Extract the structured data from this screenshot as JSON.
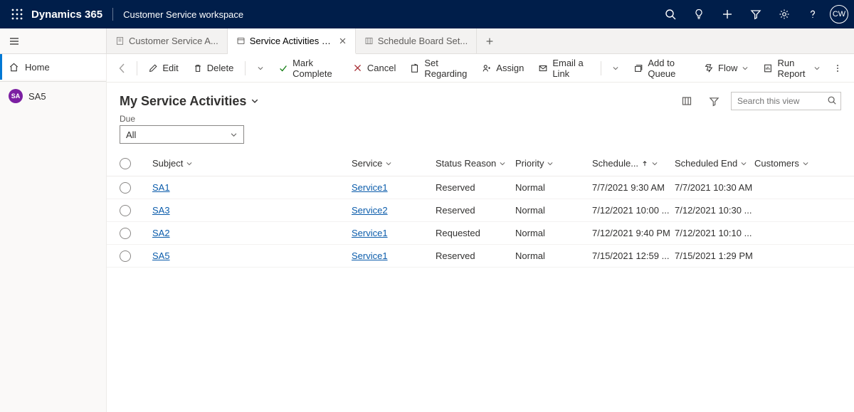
{
  "topbar": {
    "brand": "Dynamics 365",
    "area": "Customer Service workspace",
    "avatar": "CW"
  },
  "tabs": [
    {
      "label": "Customer Service A...",
      "active": false,
      "closable": false
    },
    {
      "label": "Service Activities My Ser...",
      "active": true,
      "closable": true
    },
    {
      "label": "Schedule Board Set...",
      "active": false,
      "closable": false
    }
  ],
  "sidebar": {
    "home": "Home",
    "entity_badge": "SA",
    "entity_label": "SA5"
  },
  "commands": {
    "edit": "Edit",
    "delete": "Delete",
    "mark_complete": "Mark Complete",
    "cancel": "Cancel",
    "set_regarding": "Set Regarding",
    "assign": "Assign",
    "email_link": "Email a Link",
    "add_to_queue": "Add to Queue",
    "flow": "Flow",
    "run_report": "Run Report"
  },
  "view": {
    "title": "My Service Activities",
    "search_placeholder": "Search this view",
    "due_label": "Due",
    "due_value": "All"
  },
  "columns": {
    "subject": "Subject",
    "service": "Service",
    "status": "Status Reason",
    "priority": "Priority",
    "schedule": "Schedule...",
    "scheduled_end": "Scheduled End",
    "customers": "Customers"
  },
  "rows": [
    {
      "subject": "SA1",
      "service": "Service1",
      "status": "Reserved",
      "priority": "Normal",
      "start": "7/7/2021 9:30 AM",
      "end": "7/7/2021 10:30 AM",
      "customers": ""
    },
    {
      "subject": "SA3",
      "service": "Service2",
      "status": "Reserved",
      "priority": "Normal",
      "start": "7/12/2021 10:00 ...",
      "end": "7/12/2021 10:30 ...",
      "customers": ""
    },
    {
      "subject": "SA2",
      "service": "Service1",
      "status": "Requested",
      "priority": "Normal",
      "start": "7/12/2021 9:40 PM",
      "end": "7/12/2021 10:10 ...",
      "customers": ""
    },
    {
      "subject": "SA5",
      "service": "Service1",
      "status": "Reserved",
      "priority": "Normal",
      "start": "7/15/2021 12:59 ...",
      "end": "7/15/2021 1:29 PM",
      "customers": ""
    }
  ]
}
